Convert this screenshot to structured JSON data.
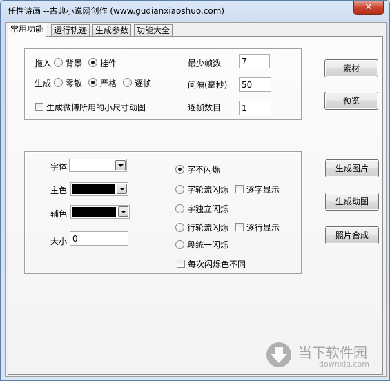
{
  "window": {
    "title": "任性诗画 --古典小说网创作 (www.gudianxiaoshuo.com)",
    "close_label": "✕"
  },
  "tabs": [
    "常用功能",
    "运行轨迹",
    "生成参数",
    "功能大全"
  ],
  "group1": {
    "insert_label": "拖入",
    "insert_options": [
      "背景",
      "挂件"
    ],
    "insert_selected": "挂件",
    "generate_label": "生成",
    "generate_options": [
      "零散",
      "严格",
      "逐帧"
    ],
    "generate_selected": "严格",
    "weibo_check_label": "生成微博所用的小尺寸动图",
    "min_frames_label": "最少帧数",
    "min_frames_value": "7",
    "interval_label": "间隔(毫秒)",
    "interval_value": "50",
    "per_frame_label": "逐帧数目",
    "per_frame_value": "1"
  },
  "group2": {
    "font_label": "字体",
    "main_color_label": "主色",
    "aux_color_label": "辅色",
    "size_label": "大小",
    "size_value": "0",
    "main_color": "#000000",
    "aux_color": "#000000",
    "flash_options": [
      "字不闪烁",
      "字轮流闪烁",
      "字独立闪烁",
      "行轮流闪烁",
      "段统一闪烁"
    ],
    "flash_selected": "字不闪烁",
    "char_show_label": "逐字显示",
    "line_show_label": "逐行显示",
    "diff_color_label": "每次闪烁色不同"
  },
  "buttons": {
    "material": "素材",
    "preview": "预览",
    "gen_image": "生成图片",
    "gen_animation": "生成动图",
    "photo_compose": "照片合成"
  },
  "watermark": {
    "text": "当下软件园",
    "url": "downxia.com"
  },
  "colors": {
    "accent": "#3c7fb1",
    "watermark": "#8a8a8a"
  }
}
